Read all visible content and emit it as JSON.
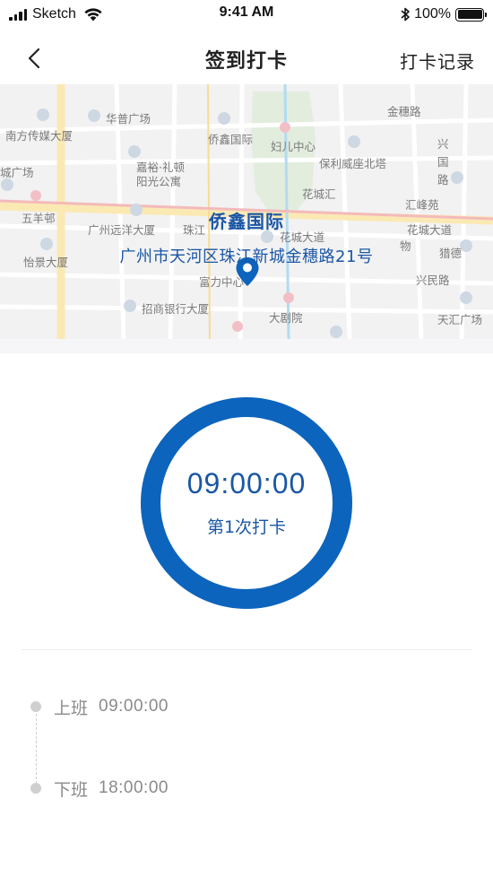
{
  "status_bar": {
    "carrier": "Sketch",
    "time": "9:41 AM",
    "battery": "100%"
  },
  "nav": {
    "title": "签到打卡",
    "record_link": "打卡记录"
  },
  "map": {
    "place_name": "侨鑫国际",
    "address": "广州市天河区珠江新城金穗路21号",
    "labels": [
      "华普广场",
      "金穗路",
      "南方传媒大厦",
      "侨鑫国际",
      "妇儿中心",
      "兴",
      "国",
      "路",
      "保利威座北塔",
      "城广场",
      "嘉裕·礼顿",
      "阳光公寓",
      "花城汇",
      "汇峰苑",
      "五羊邨",
      "广州远洋大厦",
      "珠江",
      "花城大道",
      "花城大道",
      "猎德",
      "物",
      "怡景大厦",
      "富力中心",
      "兴民路",
      "招商银行大厦",
      "大剧院",
      "天汇广场"
    ]
  },
  "clock": {
    "time": "09:00:00",
    "count_label": "第1次打卡"
  },
  "schedule": [
    {
      "label": "上班",
      "time": "09:00:00"
    },
    {
      "label": "下班",
      "time": "18:00:00"
    }
  ],
  "colors": {
    "accent": "#0c64bd",
    "accent_text": "#1a56a5",
    "muted_text": "#8a8a8a"
  }
}
